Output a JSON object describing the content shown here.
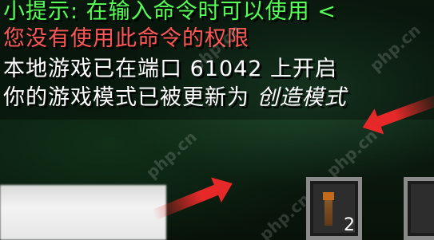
{
  "chat": {
    "lines": [
      {
        "text": "小提示: 在输入命令时可以使用 <",
        "color": "#55FF55"
      },
      {
        "text": "您没有使用此命令的权限",
        "color": "#FF5555"
      },
      {
        "text": "本地游戏已在端口 61042 上开启",
        "color": "#FFFFFF"
      },
      {
        "text_prefix": "你的游戏模式已被更新为 ",
        "text_italic": "创造模式",
        "color": "#FFFFFF"
      }
    ]
  },
  "hotbar": {
    "slots": [
      {
        "item": "torch-icon",
        "count": "2"
      },
      {
        "item": "",
        "count": ""
      }
    ]
  },
  "watermark": {
    "text": "php.cn"
  },
  "annotations": {
    "arrow_color": "#E62828"
  }
}
